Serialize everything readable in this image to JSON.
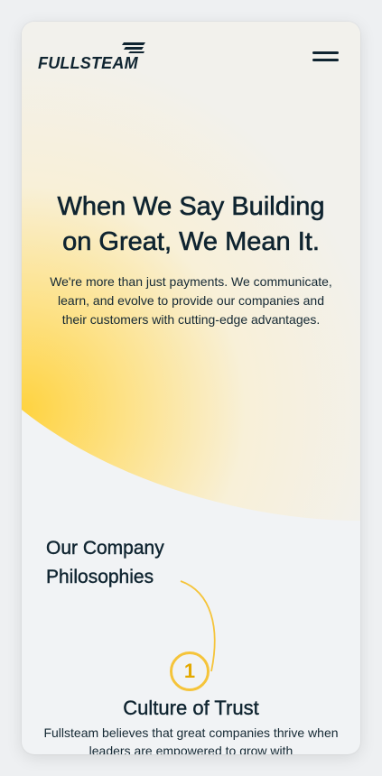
{
  "brand": {
    "name": "FULLSTEAM",
    "logo_icon": "fullsteam-flag-icon",
    "accent_color": "#f5c43a",
    "text_color": "#0f2430"
  },
  "header": {
    "menu_icon": "hamburger-menu-icon",
    "menu_label": "Menu"
  },
  "hero": {
    "title": "When We Say Building on Great, We Mean It.",
    "subtitle": "We're more than just payments. We communicate, learn, and evolve to provide our companies and their customers with cutting-edge advantages."
  },
  "philosophies": {
    "heading": "Our Company Philosophies",
    "items": [
      {
        "number": "1",
        "title": "Culture of Trust",
        "text": "Fullsteam believes that great companies thrive when leaders are empowered to grow with"
      }
    ]
  }
}
